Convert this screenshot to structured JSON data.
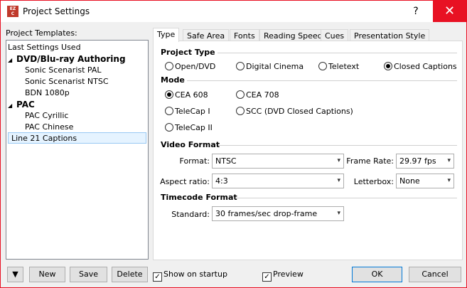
{
  "window": {
    "title": "Project Settings",
    "help_label": "?",
    "close_label": "✕",
    "app_icon_text": "EZC"
  },
  "templates": {
    "label": "Project Templates:",
    "items": [
      {
        "label": "Last Settings Used"
      },
      {
        "label": "DVD/Blu-ray Authoring",
        "arrow": "◢"
      },
      {
        "label": "Sonic Scenarist PAL"
      },
      {
        "label": "Sonic Scenarist NTSC"
      },
      {
        "label": "BDN 1080p"
      },
      {
        "label": "PAC",
        "arrow": "◢"
      },
      {
        "label": "PAC Cyrillic"
      },
      {
        "label": "PAC Chinese"
      },
      {
        "label": "Line 21 Captions",
        "selected": true
      }
    ]
  },
  "tabs": [
    "Type",
    "Safe Area",
    "Fonts",
    "Reading Speed",
    "Cues",
    "Presentation Style"
  ],
  "active_tab": "Type",
  "project_type": {
    "heading": "Project Type",
    "options": [
      "Open/DVD",
      "Digital Cinema",
      "Teletext",
      "Closed Captions"
    ],
    "selected": "Closed Captions"
  },
  "mode": {
    "heading": "Mode",
    "options": [
      "CEA 608",
      "CEA 708",
      "TeleCap I",
      "SCC (DVD Closed Captions)",
      "TeleCap II"
    ],
    "selected": "CEA 608"
  },
  "video_format": {
    "heading": "Video Format",
    "format_label": "Format:",
    "format_value": "NTSC",
    "frame_rate_label": "Frame Rate:",
    "frame_rate_value": "29.97 fps",
    "aspect_label": "Aspect ratio:",
    "aspect_value": "4:3",
    "letterbox_label": "Letterbox:",
    "letterbox_value": "None"
  },
  "timecode": {
    "heading": "Timecode Format",
    "standard_label": "Standard:",
    "standard_value": "30 frames/sec drop-frame"
  },
  "footer": {
    "menu_arrow": "▼",
    "new_label": "New",
    "save_label": "Save",
    "delete_label": "Delete",
    "show_on_startup_label": "Show on startup",
    "show_on_startup_checked": true,
    "preview_label": "Preview",
    "preview_checked": true,
    "ok_label": "OK",
    "cancel_label": "Cancel"
  },
  "chevron_glyph": "▾",
  "check_glyph": "✓",
  "colors": {
    "close_red": "#e81123",
    "selection_bg": "#e5f3ff",
    "default_button_border": "#0078d7"
  }
}
